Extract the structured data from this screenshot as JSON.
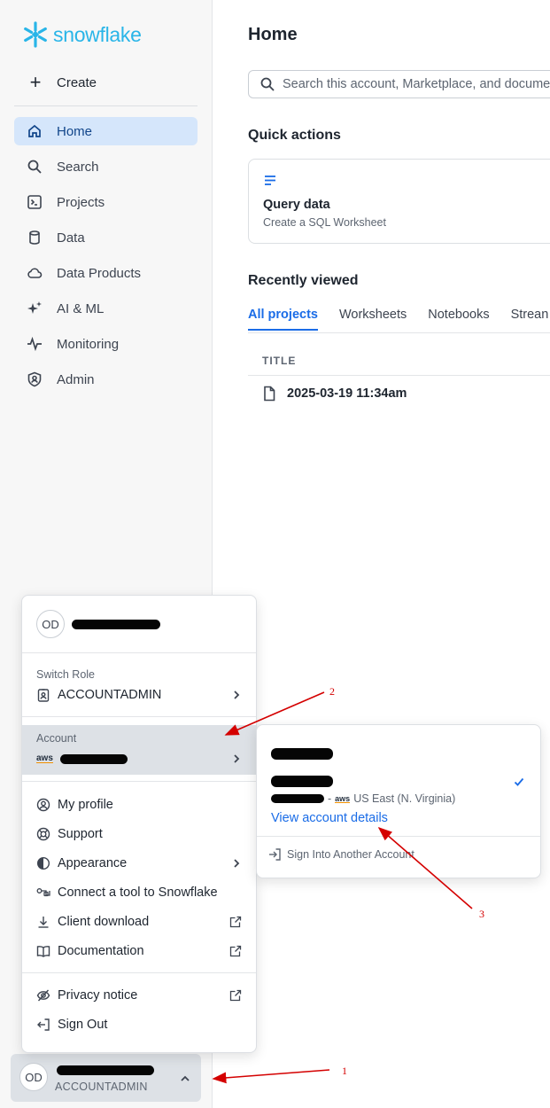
{
  "brand": {
    "name": "snowflake",
    "color": "#29b5e8"
  },
  "sidebar": {
    "create_label": "Create",
    "items": [
      {
        "label": "Home",
        "icon": "home-icon",
        "active": true
      },
      {
        "label": "Search",
        "icon": "search-icon"
      },
      {
        "label": "Projects",
        "icon": "terminal-icon"
      },
      {
        "label": "Data",
        "icon": "database-icon"
      },
      {
        "label": "Data Products",
        "icon": "cloud-icon"
      },
      {
        "label": "AI & ML",
        "icon": "sparkle-icon"
      },
      {
        "label": "Monitoring",
        "icon": "pulse-icon"
      },
      {
        "label": "Admin",
        "icon": "shield-icon"
      }
    ],
    "user_chip": {
      "initials": "OD",
      "role": "ACCOUNTADMIN"
    }
  },
  "main": {
    "title": "Home",
    "search_placeholder": "Search this account, Marketplace, and docume",
    "quick_actions_title": "Quick actions",
    "quick_action": {
      "label": "Query data",
      "sub": "Create a SQL Worksheet"
    },
    "recent_title": "Recently viewed",
    "tabs": [
      "All projects",
      "Worksheets",
      "Notebooks",
      "Strean"
    ],
    "table_header": "TITLE",
    "rows": [
      "2025-03-19 11:34am"
    ]
  },
  "menu": {
    "initials": "OD",
    "switch_role_label": "Switch Role",
    "role": "ACCOUNTADMIN",
    "account_label": "Account",
    "aws_label": "aws",
    "items": [
      {
        "label": "My profile",
        "icon": "user-circle-icon"
      },
      {
        "label": "Support",
        "icon": "lifebuoy-icon"
      },
      {
        "label": "Appearance",
        "icon": "contrast-icon",
        "chevron": true
      },
      {
        "label": "Connect a tool to Snowflake",
        "icon": "key-icon"
      },
      {
        "label": "Client download",
        "icon": "download-icon",
        "external": true
      },
      {
        "label": "Documentation",
        "icon": "book-icon",
        "external": true
      }
    ],
    "bottom_items": [
      {
        "label": "Privacy notice",
        "icon": "eye-off-icon",
        "external": true
      },
      {
        "label": "Sign Out",
        "icon": "sign-out-icon"
      }
    ]
  },
  "account_submenu": {
    "region_separator": "-",
    "aws_label": "aws",
    "region": "US East (N. Virginia)",
    "view_details": "View account details",
    "sign_into_other": "Sign Into Another Account"
  },
  "annotations": {
    "one": "1",
    "two": "2",
    "three": "3",
    "color": "#d40000"
  }
}
